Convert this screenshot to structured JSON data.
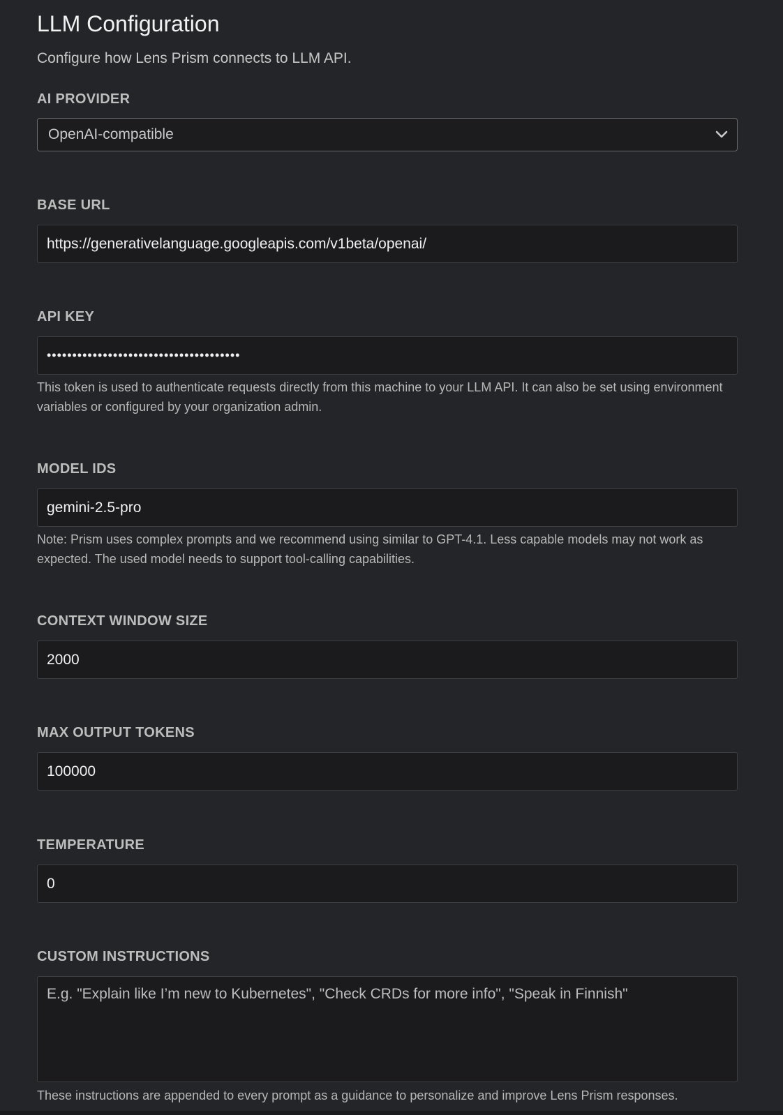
{
  "header": {
    "title": "LLM Configuration",
    "subtitle": "Configure how Lens Prism connects to LLM API."
  },
  "provider": {
    "label": "AI PROVIDER",
    "value": "OpenAI-compatible",
    "icon": "chevron-down-icon"
  },
  "base_url": {
    "label": "BASE URL",
    "value": "https://generativelanguage.googleapis.com/v1beta/openai/"
  },
  "api_key": {
    "label": "API KEY",
    "masked_value": "••••••••••••••••••••••••••••••••••••••",
    "help": "This token is used to authenticate requests directly from this machine to your LLM API. It can also be set using environment variables or configured by your organization admin."
  },
  "model_ids": {
    "label": "MODEL IDS",
    "value": "gemini-2.5-pro",
    "help": "Note: Prism uses complex prompts and we recommend using similar to GPT-4.1. Less capable models may not work as expected. The used model needs to support tool-calling capabilities."
  },
  "context_window": {
    "label": "CONTEXT WINDOW SIZE",
    "value": "2000"
  },
  "max_output_tokens": {
    "label": "MAX OUTPUT TOKENS",
    "value": "100000"
  },
  "temperature": {
    "label": "TEMPERATURE",
    "value": "0"
  },
  "custom_instructions": {
    "label": "CUSTOM INSTRUCTIONS",
    "placeholder": "E.g. \"Explain like I’m new to Kubernetes\", \"Check CRDs for more info\", \"Speak in Finnish\"",
    "help": "These instructions are appended to every prompt as a guidance to personalize and improve Lens Prism responses."
  },
  "colors": {
    "background": "#242528",
    "field_background": "#1b1b1d",
    "label": "#bdbdbd",
    "text": "#f0f0f0"
  }
}
